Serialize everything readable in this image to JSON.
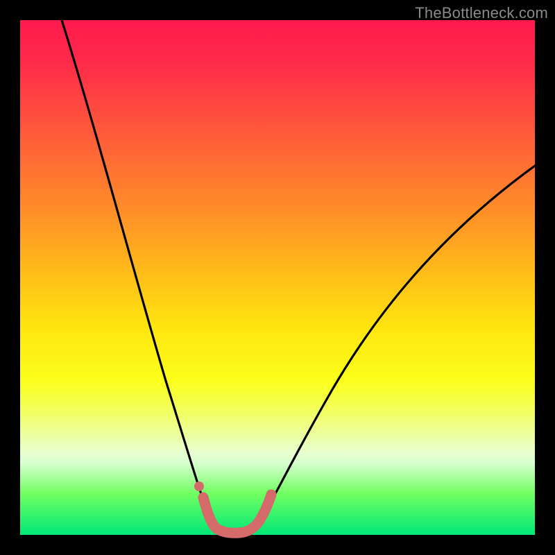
{
  "watermark": "TheBottleneck.com",
  "chart_data": {
    "type": "line",
    "title": "",
    "xlabel": "",
    "ylabel": "",
    "xlim": [
      0,
      100
    ],
    "ylim": [
      0,
      100
    ],
    "series": [
      {
        "name": "bottleneck-curve",
        "x": [
          2,
          5,
          10,
          15,
          20,
          25,
          28,
          30,
          32,
          33,
          34,
          36,
          38,
          40,
          45,
          55,
          65,
          75,
          85,
          95,
          100
        ],
        "values": [
          100,
          88,
          72,
          56,
          40,
          24,
          12,
          5,
          1,
          0,
          0,
          0,
          1,
          3,
          10,
          25,
          40,
          52,
          62,
          70,
          74
        ]
      },
      {
        "name": "highlight-band",
        "x": [
          29,
          30,
          31,
          32,
          33,
          34,
          35,
          36,
          37,
          38,
          39
        ],
        "values": [
          6,
          3,
          1,
          0.3,
          0,
          0,
          0,
          0.3,
          0.8,
          2,
          4
        ]
      },
      {
        "name": "highlight-dot",
        "x": [
          28
        ],
        "values": [
          9
        ]
      }
    ],
    "colors": {
      "curve": "#000000",
      "highlight": "#d46a6a",
      "gradient_top": "#ff1a4d",
      "gradient_mid": "#ffe60f",
      "gradient_bottom": "#00e878"
    }
  }
}
